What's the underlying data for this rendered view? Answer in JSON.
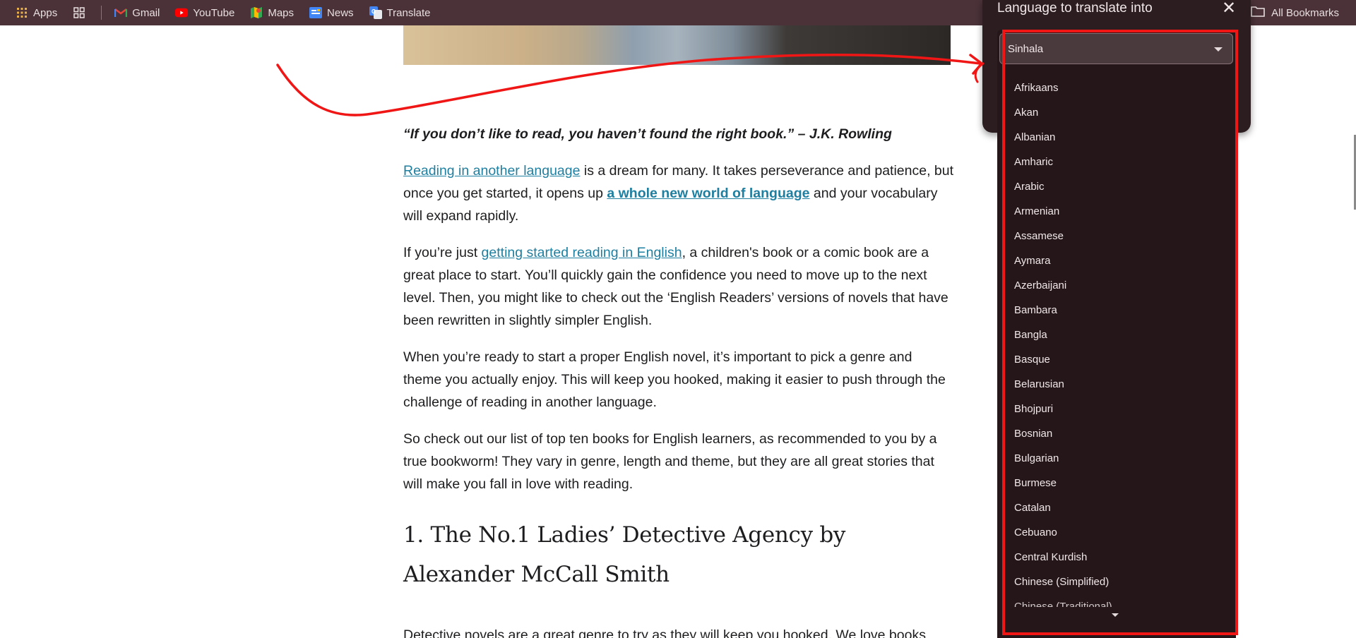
{
  "bookmarks": {
    "items": [
      {
        "label": "Apps",
        "icon": "apps-grid-icon"
      },
      {
        "label": "",
        "icon": "tab-groups-icon"
      },
      {
        "label": "Gmail",
        "icon": "gmail-icon"
      },
      {
        "label": "YouTube",
        "icon": "youtube-icon"
      },
      {
        "label": "Maps",
        "icon": "maps-icon"
      },
      {
        "label": "News",
        "icon": "news-icon"
      },
      {
        "label": "Translate",
        "icon": "translate-icon"
      }
    ],
    "all_label": "All Bookmarks"
  },
  "article": {
    "quote": "“If you don’t like to read, you haven’t found the right book.” – J.K. Rowling",
    "p1_link": "Reading in another language",
    "p1_a": " is a dream for many. It takes perseverance and patience, but once you get started, it opens up ",
    "p1_link2": "a whole new world of language",
    "p1_b": " and your vocabulary will expand rapidly.",
    "p2_a": "If you’re just ",
    "p2_link": "getting started reading in English",
    "p2_b": ", a children's book or a comic book are a great place to start. You’ll quickly gain the confidence you need to move up to the next level. Then, you might like to check out the ‘English Readers’ versions of novels that have been rewritten in slightly simpler English.",
    "p3": "When you’re ready to start a proper English novel, it’s important to pick a genre and theme you actually enjoy. This will keep you hooked, making it easier to push through the challenge of reading in another language.",
    "p4": "So check out our list of top ten books for English learners, as recommended to you by a true bookworm! They vary in genre, length and theme, but they are all great stories that will make you fall in love with reading.",
    "h2": "1. The No.1 Ladies’ Detective Agency by Alexander McCall Smith",
    "p5": "Detective novels are a great genre to try as they will keep you hooked. We love books"
  },
  "translate_popup": {
    "title": "Language to translate into",
    "selected": "Sinhala",
    "languages": [
      "Afrikaans",
      "Akan",
      "Albanian",
      "Amharic",
      "Arabic",
      "Armenian",
      "Assamese",
      "Aymara",
      "Azerbaijani",
      "Bambara",
      "Bangla",
      "Basque",
      "Belarusian",
      "Bhojpuri",
      "Bosnian",
      "Bulgarian",
      "Burmese",
      "Catalan",
      "Cebuano",
      "Central Kurdish",
      "Chinese (Simplified)",
      "Chinese (Traditional)"
    ]
  },
  "colors": {
    "bookmarks_bg": "#4a3238",
    "popup_bg": "#2b1d20",
    "link": "#1e7fa0",
    "annotation_red": "#f01616"
  }
}
